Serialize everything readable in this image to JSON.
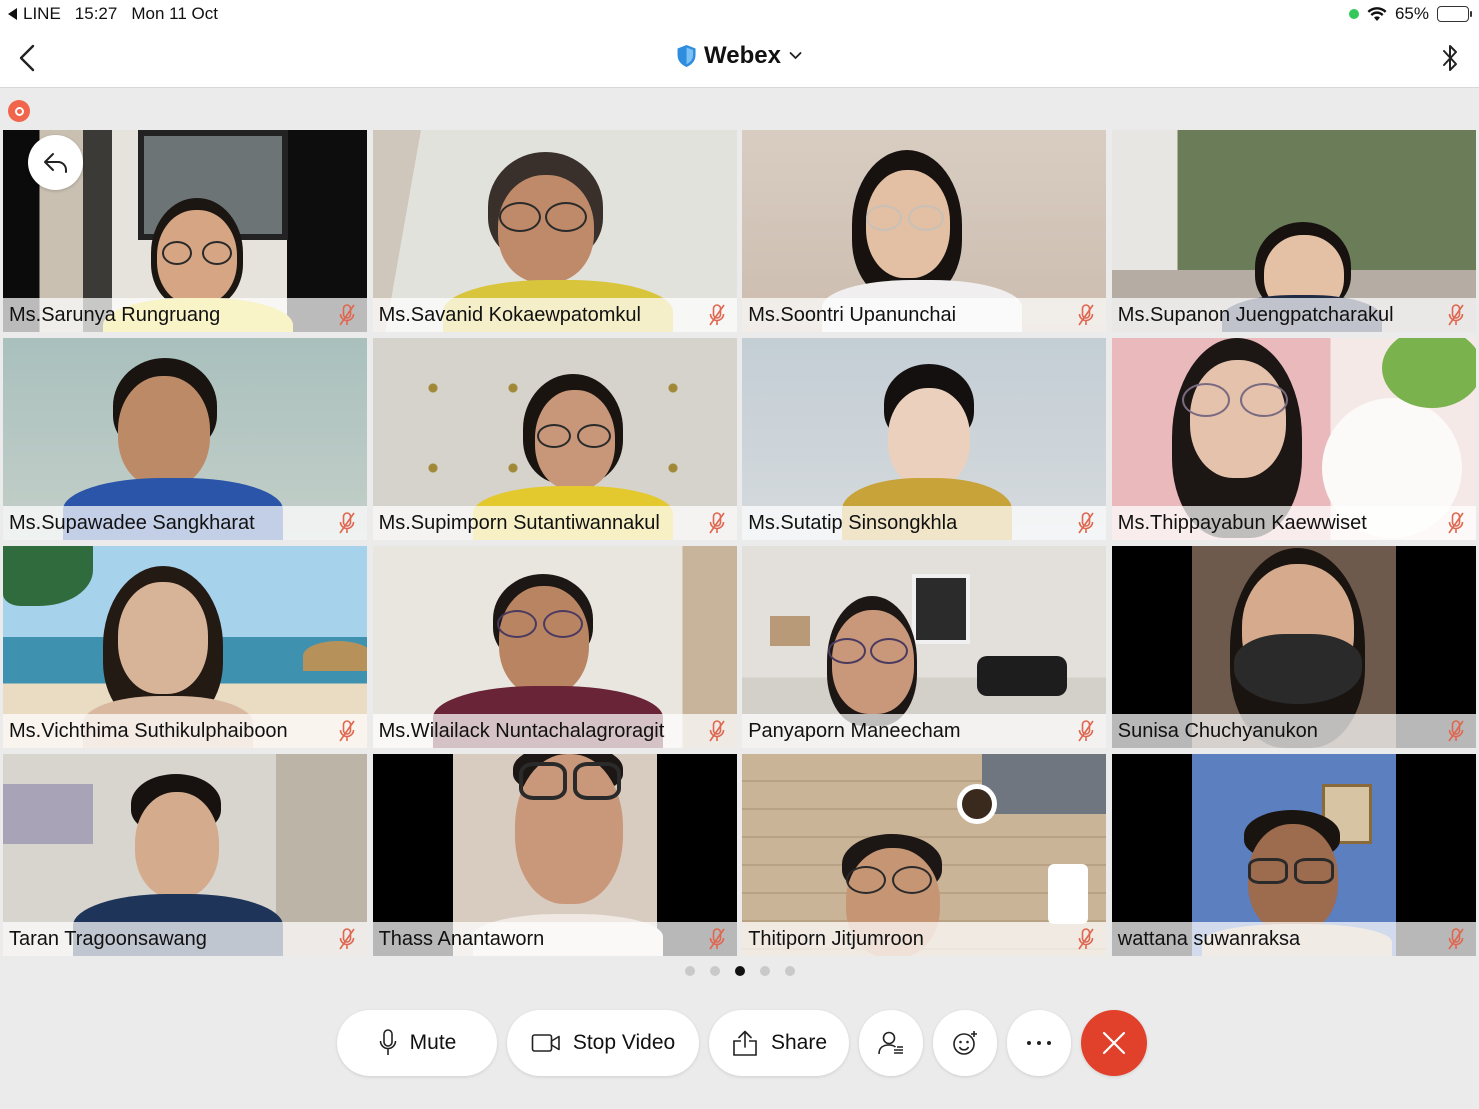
{
  "status_bar": {
    "back_app": "LINE",
    "time": "15:27",
    "date": "Mon 11 Oct",
    "battery": "65%",
    "battery_level": 0.65
  },
  "nav": {
    "title": "Webex"
  },
  "participants": [
    {
      "name": "Ms.Sarunya Rungruang",
      "muted": true
    },
    {
      "name": "Ms.Savanid Kokaewpatomkul",
      "muted": true
    },
    {
      "name": "Ms.Soontri Upanunchai",
      "muted": true
    },
    {
      "name": "Ms.Supanon Juengpatcharakul",
      "muted": true
    },
    {
      "name": "Ms.Supawadee Sangkharat",
      "muted": true
    },
    {
      "name": "Ms.Supimporn Sutantiwannakul",
      "muted": true
    },
    {
      "name": "Ms.Sutatip Sinsongkhla",
      "muted": true
    },
    {
      "name": "Ms.Thippayabun Kaewwiset",
      "muted": true
    },
    {
      "name": "Ms.Vichthima Suthikulphaiboon",
      "muted": true
    },
    {
      "name": "Ms.Wilailack Nuntachalagroragit",
      "muted": true
    },
    {
      "name": "Panyaporn Maneecham",
      "muted": true
    },
    {
      "name": "Sunisa Chuchyanukon",
      "muted": true
    },
    {
      "name": "Taran Tragoonsawang",
      "muted": true
    },
    {
      "name": "Thass Anantaworn",
      "muted": true
    },
    {
      "name": "Thitiporn Jitjumroon",
      "muted": true
    },
    {
      "name": "wattana suwanraksa",
      "muted": true
    }
  ],
  "pagination": {
    "total": 5,
    "current": 3
  },
  "controls": {
    "mute_label": "Mute",
    "stop_video_label": "Stop Video",
    "share_label": "Share"
  },
  "colors": {
    "end_call": "#e1412a",
    "record": "#f0654b",
    "mute_icon": "#e0664f"
  }
}
